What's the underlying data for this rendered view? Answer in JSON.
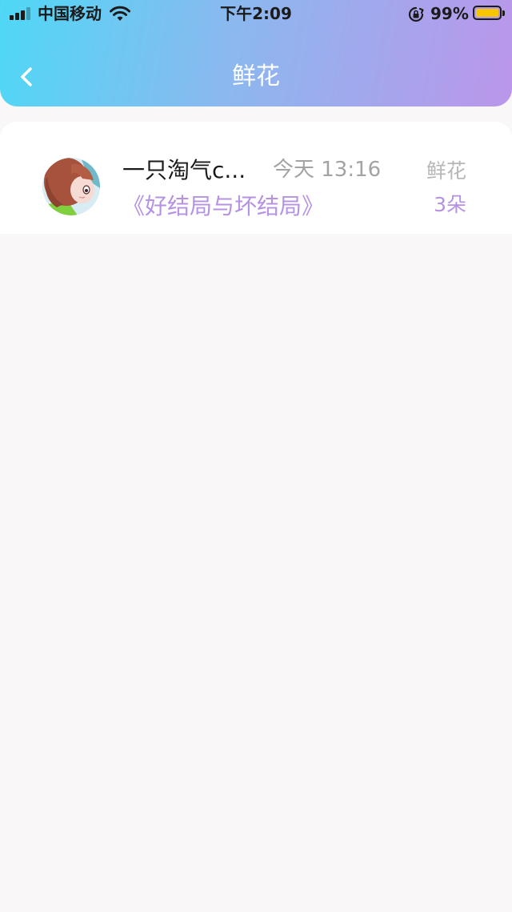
{
  "status_bar": {
    "carrier": "中国移动",
    "time": "下午2:09",
    "battery_percent": "99%",
    "battery_level": 0.99,
    "icons": [
      "signal-icon",
      "wifi-icon",
      "orientation-lock-icon",
      "battery-icon"
    ]
  },
  "header": {
    "title": "鲜花",
    "back_icon": "chevron-left-icon"
  },
  "colors": {
    "header_gradient_start": "#4fd8f6",
    "header_gradient_end": "#bb96ea",
    "accent_purple": "#b592e3",
    "battery_yellow": "#f7c600"
  },
  "records": [
    {
      "username": "一只淘气c...",
      "time": "今天 13:16",
      "book_title": "《好结局与坏结局》",
      "gift_type": "鲜花",
      "gift_count": "3朵"
    }
  ]
}
